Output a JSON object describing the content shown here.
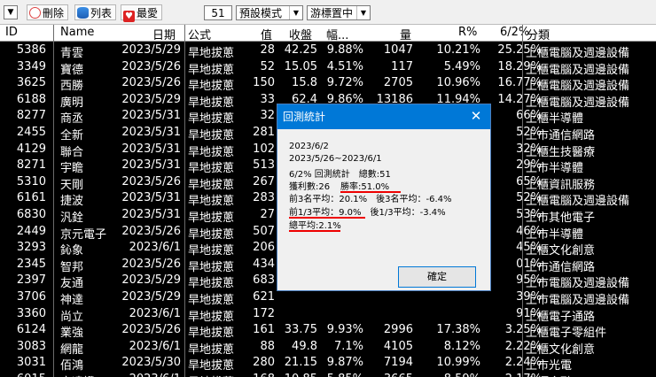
{
  "toolbar": {
    "delete_label": "刪除",
    "list_label": "列表",
    "favorite_label": "最愛",
    "count_value": "51",
    "mode_value": "預設模式",
    "cursor_value": "游標置中"
  },
  "columns": [
    "ID",
    "Name",
    "日期",
    "公式",
    "值",
    "收盤",
    "幅...",
    "量",
    "R%",
    "6/2%",
    "分類"
  ],
  "rows": [
    {
      "id": "5386",
      "name": "青雲",
      "date": "2023/5/29",
      "formula": "旱地拔蔥",
      "val": "28",
      "close": "42.25",
      "chg": "9.88%",
      "vol": "1047",
      "r": "10.21%",
      "p62": "25.25%",
      "cat": "上櫃電腦及週邊設備"
    },
    {
      "id": "3349",
      "name": "寶德",
      "date": "2023/5/26",
      "formula": "旱地拔蔥",
      "val": "52",
      "close": "15.05",
      "chg": "4.51%",
      "vol": "117",
      "r": "5.49%",
      "p62": "18.29%",
      "cat": "上櫃電腦及週邊設備"
    },
    {
      "id": "3625",
      "name": "西勝",
      "date": "2023/5/26",
      "formula": "旱地拔蔥",
      "val": "150",
      "close": "15.8",
      "chg": "9.72%",
      "vol": "2705",
      "r": "10.96%",
      "p62": "16.77%",
      "cat": "上櫃電腦及週邊設備"
    },
    {
      "id": "6188",
      "name": "廣明",
      "date": "2023/5/29",
      "formula": "旱地拔蔥",
      "val": "33",
      "close": "62.4",
      "chg": "9.86%",
      "vol": "13186",
      "r": "11.94%",
      "p62": "14.27%",
      "cat": "上櫃電腦及週邊設備"
    },
    {
      "id": "8277",
      "name": "商丞",
      "date": "2023/5/31",
      "formula": "旱地拔蔥",
      "val": "32",
      "close": "",
      "chg": "",
      "vol": "",
      "r": "",
      "p62": "66%",
      "cat": "上櫃半導體"
    },
    {
      "id": "2455",
      "name": "全新",
      "date": "2023/5/31",
      "formula": "旱地拔蔥",
      "val": "281",
      "close": "",
      "chg": "",
      "vol": "",
      "r": "",
      "p62": "52%",
      "cat": "上市通信網路"
    },
    {
      "id": "4129",
      "name": "聯合",
      "date": "2023/5/31",
      "formula": "旱地拔蔥",
      "val": "102",
      "close": "",
      "chg": "",
      "vol": "",
      "r": "",
      "p62": "32%",
      "cat": "上櫃生技醫療"
    },
    {
      "id": "8271",
      "name": "宇瞻",
      "date": "2023/5/31",
      "formula": "旱地拔蔥",
      "val": "513",
      "close": "",
      "chg": "",
      "vol": "",
      "r": "",
      "p62": "29%",
      "cat": "上市半導體"
    },
    {
      "id": "5310",
      "name": "天剛",
      "date": "2023/5/26",
      "formula": "旱地拔蔥",
      "val": "267",
      "close": "",
      "chg": "",
      "vol": "",
      "r": "",
      "p62": "65%",
      "cat": "上櫃資訊服務"
    },
    {
      "id": "6161",
      "name": "捷波",
      "date": "2023/5/31",
      "formula": "旱地拔蔥",
      "val": "283",
      "close": "",
      "chg": "",
      "vol": "",
      "r": "",
      "p62": "52%",
      "cat": "上櫃電腦及週邊設備"
    },
    {
      "id": "6830",
      "name": "汎銓",
      "date": "2023/5/31",
      "formula": "旱地拔蔥",
      "val": "27",
      "close": "",
      "chg": "",
      "vol": "",
      "r": "",
      "p62": "53%",
      "cat": "上市其他電子"
    },
    {
      "id": "2449",
      "name": "京元電子",
      "date": "2023/5/26",
      "formula": "旱地拔蔥",
      "val": "507",
      "close": "",
      "chg": "",
      "vol": "",
      "r": "",
      "p62": "46%",
      "cat": "上市半導體"
    },
    {
      "id": "3293",
      "name": "鈊象",
      "date": "2023/6/1",
      "formula": "旱地拔蔥",
      "val": "206",
      "close": "",
      "chg": "",
      "vol": "",
      "r": "",
      "p62": "45%",
      "cat": "上櫃文化創意"
    },
    {
      "id": "2345",
      "name": "智邦",
      "date": "2023/5/26",
      "formula": "旱地拔蔥",
      "val": "434",
      "close": "",
      "chg": "",
      "vol": "",
      "r": "",
      "p62": "01%",
      "cat": "上市通信網路"
    },
    {
      "id": "2397",
      "name": "友通",
      "date": "2023/5/29",
      "formula": "旱地拔蔥",
      "val": "683",
      "close": "",
      "chg": "",
      "vol": "",
      "r": "",
      "p62": "95%",
      "cat": "上市電腦及週邊設備"
    },
    {
      "id": "3706",
      "name": "神達",
      "date": "2023/5/29",
      "formula": "旱地拔蔥",
      "val": "621",
      "close": "",
      "chg": "",
      "vol": "",
      "r": "",
      "p62": "39%",
      "cat": "上市電腦及週邊設備"
    },
    {
      "id": "3360",
      "name": "尚立",
      "date": "2023/6/1",
      "formula": "旱地拔蔥",
      "val": "172",
      "close": "",
      "chg": "",
      "vol": "",
      "r": "",
      "p62": "91%",
      "cat": "上櫃電子通路"
    },
    {
      "id": "6124",
      "name": "業強",
      "date": "2023/5/26",
      "formula": "旱地拔蔥",
      "val": "161",
      "close": "33.75",
      "chg": "9.93%",
      "vol": "2996",
      "r": "17.38%",
      "p62": "3.25%",
      "cat": "上櫃電子零組件"
    },
    {
      "id": "3083",
      "name": "網龍",
      "date": "2023/6/1",
      "formula": "旱地拔蔥",
      "val": "88",
      "close": "49.8",
      "chg": "7.1%",
      "vol": "4105",
      "r": "8.12%",
      "p62": "2.22%",
      "cat": "上櫃文化創意"
    },
    {
      "id": "3031",
      "name": "佰鴻",
      "date": "2023/5/30",
      "formula": "旱地拔蔥",
      "val": "280",
      "close": "21.15",
      "chg": "9.87%",
      "vol": "7194",
      "r": "10.99%",
      "p62": "2.24%",
      "cat": "上市光電"
    },
    {
      "id": "6015",
      "name": "宏遠證",
      "date": "2023/6/1",
      "formula": "旱地拔蔥",
      "val": "168",
      "close": "10.85",
      "chg": "5.85%",
      "vol": "3665",
      "r": "8.59%",
      "p62": "2.17%",
      "cat": "上櫃金融"
    }
  ],
  "dialog": {
    "title": "回測統計",
    "close_glyph": "✕",
    "date": "2023/6/2",
    "range": "2023/5/26~2023/6/1",
    "summary": "6/2% 回測統計　總數:51",
    "profit": "獲利數:26",
    "winrate": "勝率:51.0%",
    "top3": "前3名平均：20.1%　後3名平均：-6.4%",
    "third": "前1/3平均：9.0%　後1/3平均：-3.4%",
    "total": "總平均:2.1%",
    "ok_label": "確定"
  }
}
